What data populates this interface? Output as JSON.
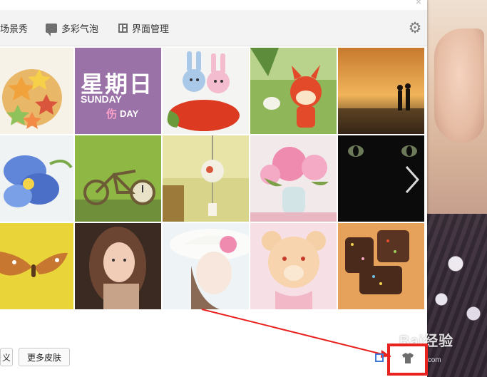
{
  "toolbar": {
    "items": [
      {
        "label": "场景秀"
      },
      {
        "label": "多彩气泡",
        "icon": "chat-bubble-icon"
      },
      {
        "label": "界面管理",
        "icon": "layout-icon"
      }
    ],
    "settings_icon": "gear-icon"
  },
  "grid": {
    "tiles": [
      {
        "name": "tile-candy-stars"
      },
      {
        "name": "tile-sunday",
        "title": "星期日",
        "sub1": "SUNDAY",
        "sub2": "伤",
        "sub3": "DAY"
      },
      {
        "name": "tile-knit-bunnies"
      },
      {
        "name": "tile-cartoon-fox"
      },
      {
        "name": "tile-sunset-couple"
      },
      {
        "name": "tile-blue-flower"
      },
      {
        "name": "tile-bicycle-clock"
      },
      {
        "name": "tile-wind-chime"
      },
      {
        "name": "tile-peonies-vase"
      },
      {
        "name": "tile-black-cat"
      },
      {
        "name": "tile-butterfly"
      },
      {
        "name": "tile-girl-portrait"
      },
      {
        "name": "tile-hat-girl"
      },
      {
        "name": "tile-teddy-bear"
      },
      {
        "name": "tile-chocolate-sprinkles"
      }
    ],
    "next_icon": "chevron-right-icon"
  },
  "bottom": {
    "left_button_label": "义",
    "more_skins_label": "更多皮肤"
  },
  "watermark": {
    "text": "Bai经验",
    "sub": "jingyan.baidu.com"
  },
  "colors": {
    "highlight": "#e8231f",
    "toolbar_bg": "#f3f3f3"
  }
}
